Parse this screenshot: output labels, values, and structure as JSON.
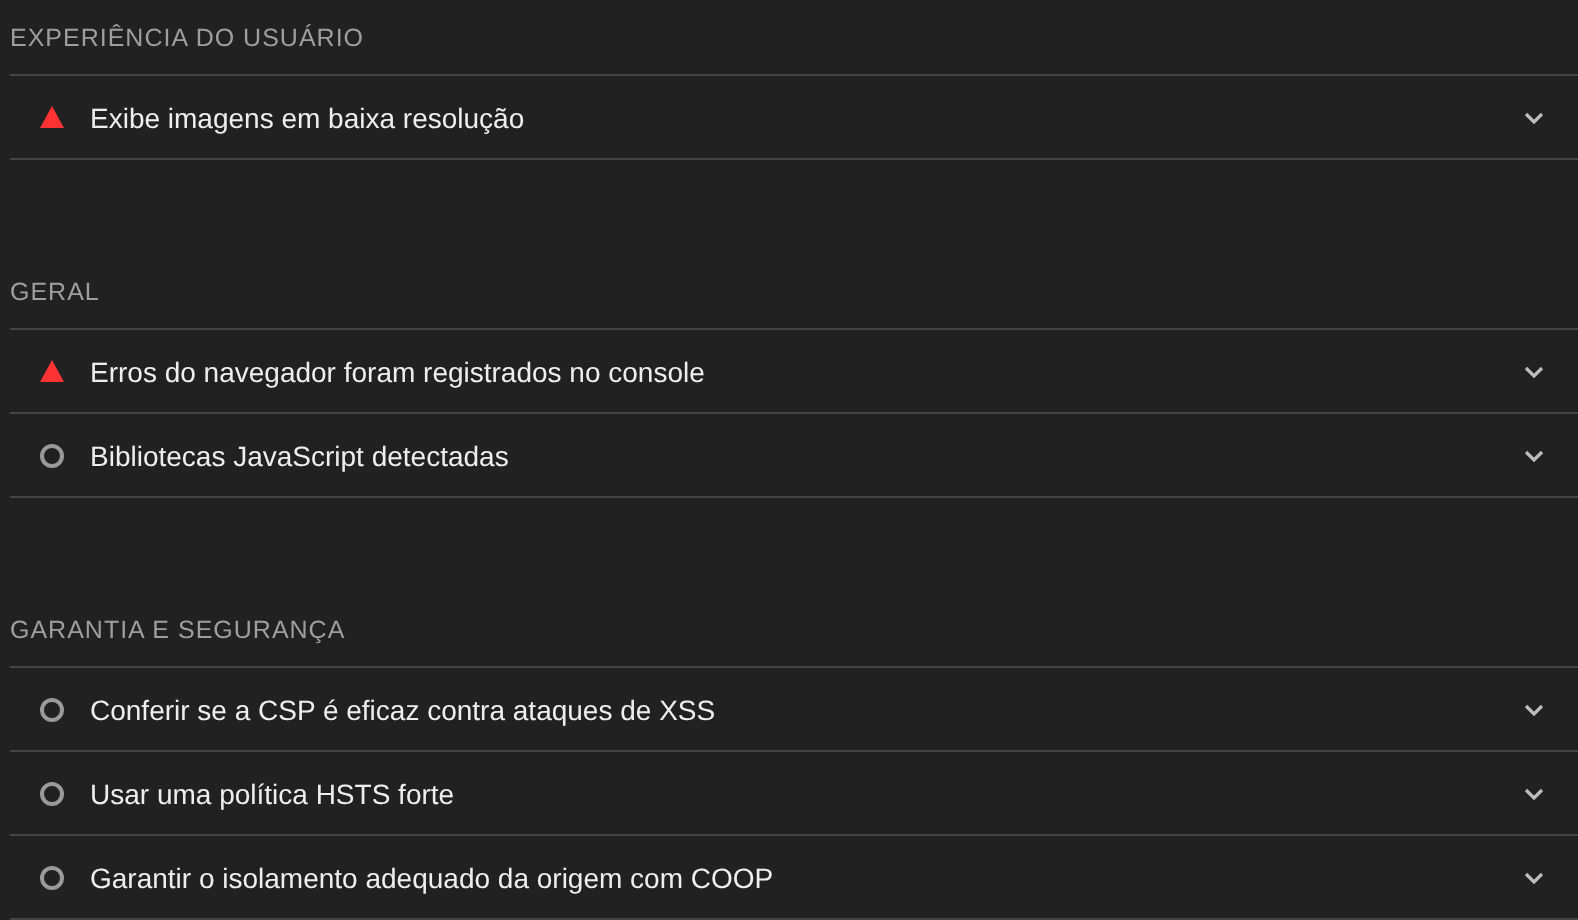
{
  "sections": [
    {
      "title": "EXPERIÊNCIA DO USUÁRIO",
      "audits": [
        {
          "kind": "fail",
          "label": "Exibe imagens em baixa resolução",
          "expanded": false
        }
      ]
    },
    {
      "title": "GERAL",
      "audits": [
        {
          "kind": "fail",
          "label": "Erros do navegador foram registrados no console",
          "expanded": false
        },
        {
          "kind": "info",
          "label": "Bibliotecas JavaScript detectadas",
          "expanded": false
        }
      ]
    },
    {
      "title": "GARANTIA E SEGURANÇA",
      "audits": [
        {
          "kind": "info",
          "label": "Conferir se a CSP é eficaz contra ataques de XSS",
          "expanded": false
        },
        {
          "kind": "info",
          "label": "Usar uma política HSTS forte",
          "expanded": false
        },
        {
          "kind": "info",
          "label": "Garantir o isolamento adequado da origem com COOP",
          "expanded": false
        }
      ]
    }
  ]
}
